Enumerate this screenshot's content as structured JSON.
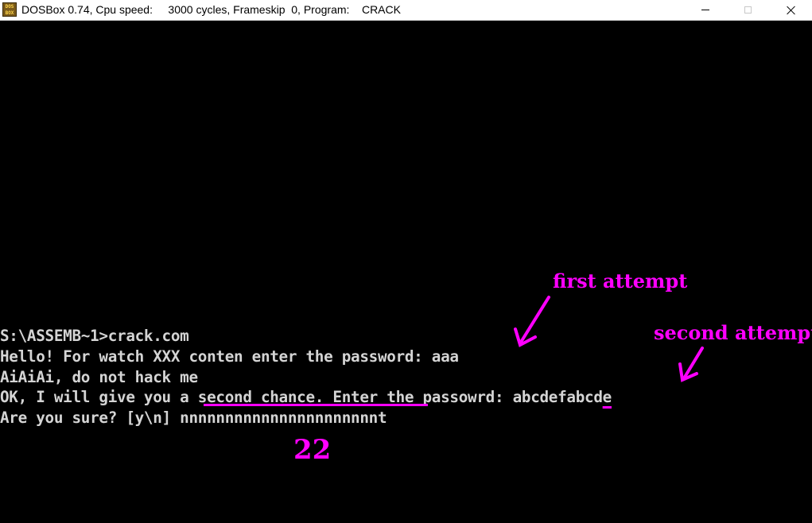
{
  "window": {
    "app_icon_text": "DOS BOX",
    "title": "DOSBox 0.74, Cpu speed:     3000 cycles, Frameskip  0, Program:    CRACK"
  },
  "console": {
    "lines": [
      "S:\\ASSEMB~1>crack.com",
      "Hello! For watch XXX conten enter the password: aaa",
      "AiAiAi, do not hack me",
      "OK, I will give you a second chance. Enter the passowrd: abcdefabcd",
      "Are you sure? [y\\n] nnnnnnnnnnnnnnnnnnnnnnt"
    ],
    "line4_highlight": "e"
  },
  "annotations": {
    "first_attempt": "first attempt",
    "second_attempt": "second attempt",
    "count": "22",
    "color": "#ff00ff"
  }
}
